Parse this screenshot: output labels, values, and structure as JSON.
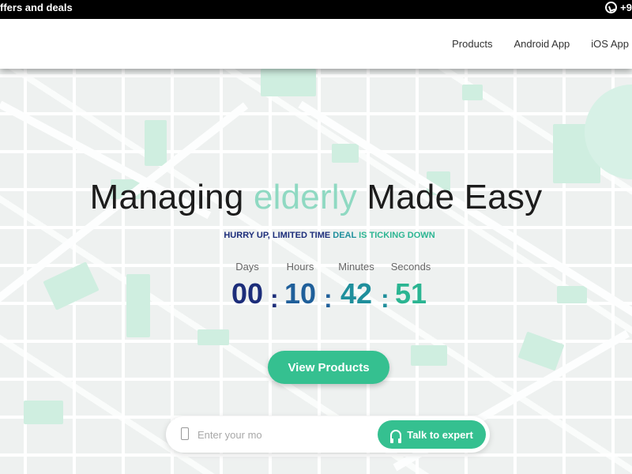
{
  "topbar": {
    "promo": "ffers and deals",
    "phone": "+9"
  },
  "nav": {
    "items": [
      "Products",
      "Android App",
      "iOS App"
    ]
  },
  "hero": {
    "title_pre": "Managing ",
    "title_accent": "elderly",
    "title_post": " Made Easy",
    "tagline_p1": "HURRY UP, LIMITED TIME ",
    "tagline_p2": "DEAL",
    "tagline_p3": " IS TICKING DOWN"
  },
  "countdown": {
    "labels": [
      "Days",
      "Hours",
      "Minutes",
      "Seconds"
    ],
    "values": [
      "00",
      "10",
      "42",
      "51"
    ],
    "separator": ":",
    "colors": [
      "#1c2d7a",
      "#1f5f9a",
      "#1f8f9c",
      "#2bb592"
    ]
  },
  "cta": {
    "view_products": "View Products"
  },
  "phone_form": {
    "placeholder": "Enter your mo",
    "talk_label": "Talk to expert"
  },
  "colors": {
    "accent": "#35c090",
    "title_accent": "#8fd9c2",
    "navy": "#1c2d7a"
  }
}
